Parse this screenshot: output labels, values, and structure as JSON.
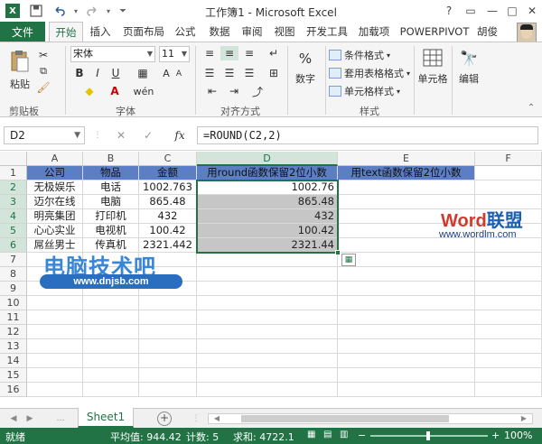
{
  "window": {
    "title": "工作簿1 - Microsoft Excel",
    "controls": {
      "help": "?",
      "restore": "▭",
      "minimize": "—",
      "maximize": "□",
      "close": "✕"
    }
  },
  "quick_access": {
    "save": "save-icon",
    "undo": "undo-icon",
    "redo": "redo-icon"
  },
  "ribbon_tabs": {
    "file": "文件",
    "tabs": [
      "开始",
      "插入",
      "页面布局",
      "公式",
      "数据",
      "审阅",
      "视图",
      "开发工具",
      "加载项",
      "POWERPIVOT"
    ],
    "active": "开始",
    "user": "胡俊"
  },
  "ribbon": {
    "clipboard": {
      "paste": "粘贴",
      "label": "剪贴板"
    },
    "font": {
      "name": "宋体",
      "size": "11",
      "label": "字体",
      "bold": "B",
      "italic": "I",
      "underline": "U",
      "font_color": "A"
    },
    "alignment": {
      "label": "对齐方式"
    },
    "number": {
      "btn": "数字",
      "symbol": "%"
    },
    "styles": {
      "conditional": "条件格式",
      "table": "套用表格格式",
      "cell": "单元格样式",
      "label": "样式"
    },
    "cells": {
      "btn": "单元格"
    },
    "editing": {
      "btn": "编辑"
    }
  },
  "formula_bar": {
    "name_box": "D2",
    "fx": "fx",
    "formula": "=ROUND(C2,2)"
  },
  "grid": {
    "columns": [
      "A",
      "B",
      "C",
      "D",
      "E",
      "F"
    ],
    "rows": [
      "1",
      "2",
      "3",
      "4",
      "5",
      "6",
      "7",
      "8",
      "9",
      "10",
      "11",
      "12",
      "13",
      "14",
      "15",
      "16"
    ],
    "header_row": [
      "公司",
      "物品",
      "金额",
      "用round函数保留2位小数",
      "用text函数保留2位小数"
    ],
    "data": [
      [
        "无极娱乐",
        "电话",
        "1002.763",
        "1002.76"
      ],
      [
        "迈尔在线",
        "电脑",
        "865.48",
        "865.48"
      ],
      [
        "明亮集团",
        "打印机",
        "432",
        "432"
      ],
      [
        "心心实业",
        "电视机",
        "100.42",
        "100.42"
      ],
      [
        "屌丝男士",
        "传真机",
        "2321.442",
        "2321.44"
      ]
    ]
  },
  "watermarks": {
    "word_brand_a": "Word",
    "word_brand_b": "联盟",
    "word_url": "www.wordlm.com",
    "cn_brand": "电脑技术吧",
    "cn_url": "www.dnjsb.com"
  },
  "sheets": {
    "tabs": [
      "Sheet1"
    ],
    "add": "+"
  },
  "status": {
    "ready": "就绪",
    "average": "平均值: 944.42",
    "count": "计数: 5",
    "sum": "求和: 4722.1",
    "zoom": "100%"
  }
}
